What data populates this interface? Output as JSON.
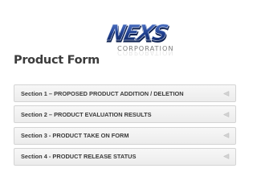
{
  "logo": {
    "mark_text": "NEXS",
    "word_text": "CORPORATION",
    "colors": {
      "mark": "#1f3f8f",
      "mark_shadow": "#0f2252",
      "word": "#7a7a7a"
    }
  },
  "page": {
    "title": "Product Form"
  },
  "sections": [
    {
      "label": "Section 1 – PROPOSED PRODUCT ADDITION / DELETION",
      "icon": "chevron-left-icon"
    },
    {
      "label": "Section 2 – PRODUCT EVALUATION RESULTS",
      "icon": "chevron-left-icon"
    },
    {
      "label": "Section 3 - PRODUCT TAKE ON FORM",
      "icon": "chevron-left-icon"
    },
    {
      "label": "Section 4 - PRODUCT RELEASE STATUS",
      "icon": "chevron-left-icon"
    }
  ],
  "colors": {
    "section_bg": "#efefef",
    "section_border": "#d4d4d4",
    "text": "#3a3a3a",
    "caret": "#c8c8c8"
  }
}
